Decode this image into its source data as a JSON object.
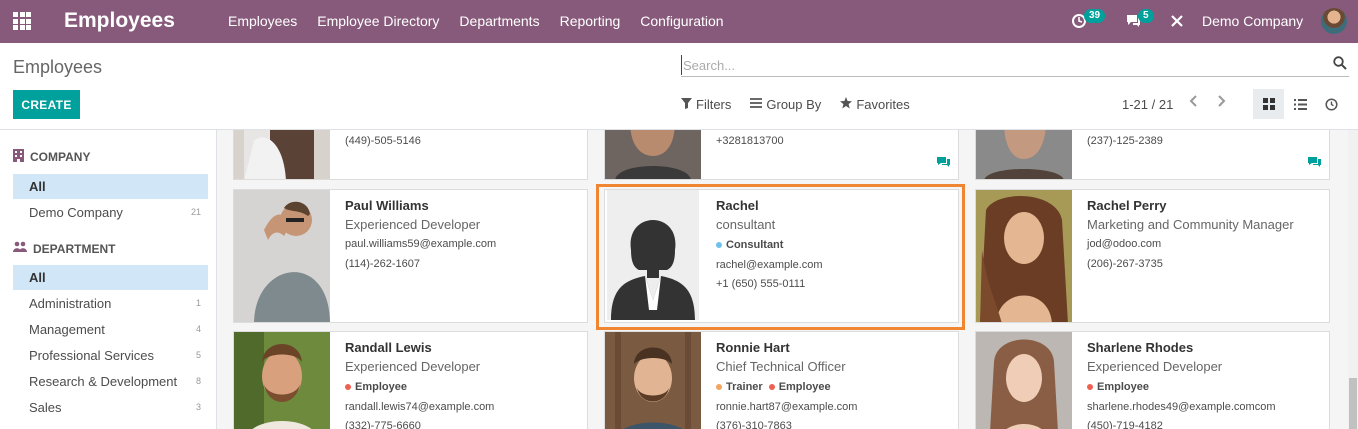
{
  "nav": {
    "app_title": "Employees",
    "menu": [
      "Employees",
      "Employee Directory",
      "Departments",
      "Reporting",
      "Configuration"
    ],
    "activity_count": "39",
    "messages_count": "5",
    "company": "Demo Company"
  },
  "control": {
    "breadcrumb": "Employees",
    "create_label": "CREATE",
    "search_placeholder": "Search...",
    "filters_label": "Filters",
    "groupby_label": "Group By",
    "favorites_label": "Favorites",
    "pager": "1-21 / 21"
  },
  "sidebar": {
    "company_header": "COMPANY",
    "company_items": [
      {
        "label": "All",
        "count": ""
      },
      {
        "label": "Demo Company",
        "count": "21"
      }
    ],
    "department_header": "DEPARTMENT",
    "department_items": [
      {
        "label": "All",
        "count": ""
      },
      {
        "label": "Administration",
        "count": "1"
      },
      {
        "label": "Management",
        "count": "4"
      },
      {
        "label": "Professional Services",
        "count": "5"
      },
      {
        "label": "Research & Development",
        "count": "8"
      },
      {
        "label": "Sales",
        "count": "3"
      }
    ]
  },
  "cards": {
    "top": [
      {
        "phone": "(449)-505-5146"
      },
      {
        "phone": "+3281813700"
      },
      {
        "phone": "(237)-125-2389"
      }
    ],
    "paul": {
      "name": "Paul Williams",
      "job": "Experienced Developer",
      "email": "paul.williams59@example.com",
      "phone": "(114)-262-1607"
    },
    "rachel": {
      "name": "Rachel",
      "job": "consultant",
      "tag": "Consultant",
      "email": "rachel@example.com",
      "phone": "+1 (650) 555-0111"
    },
    "rachel_perry": {
      "name": "Rachel Perry",
      "job": "Marketing and Community Manager",
      "email": "jod@odoo.com",
      "phone": "(206)-267-3735"
    },
    "randall": {
      "name": "Randall Lewis",
      "job": "Experienced Developer",
      "tag": "Employee",
      "email": "randall.lewis74@example.com",
      "phone": "(332)-775-6660"
    },
    "ronnie": {
      "name": "Ronnie Hart",
      "job": "Chief Technical Officer",
      "tag1": "Trainer",
      "tag2": "Employee",
      "email": "ronnie.hart87@example.com",
      "phone": "(376)-310-7863"
    },
    "sharlene": {
      "name": "Sharlene Rhodes",
      "job": "Experienced Developer",
      "tag": "Employee",
      "email": "sharlene.rhodes49@example.comcom",
      "phone": "(450)-719-4182"
    }
  },
  "colors": {
    "brand": "#875a7b",
    "accent": "#00a09d",
    "highlight": "#f08632",
    "tag_consultant": "#6cc1ed",
    "tag_employee": "#f06050",
    "tag_trainer": "#f4a460"
  }
}
